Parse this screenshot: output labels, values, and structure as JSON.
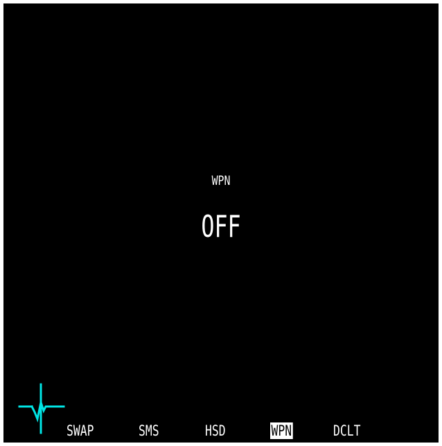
{
  "format": {
    "title": "WPN",
    "status": "OFF"
  },
  "bottom_osb": [
    {
      "label": "SWAP",
      "selected": false
    },
    {
      "label": "SMS",
      "selected": false
    },
    {
      "label": "HSD",
      "selected": false
    },
    {
      "label": "WPN",
      "selected": true
    },
    {
      "label": "DCLT",
      "selected": false
    }
  ],
  "colors": {
    "background": "#000000",
    "text": "#ffffff",
    "freeze_symbol": "#00e5e5",
    "frame": "#ffffff"
  },
  "icons": {
    "freeze_symbol": "fcr-freeze-symbol-icon"
  }
}
